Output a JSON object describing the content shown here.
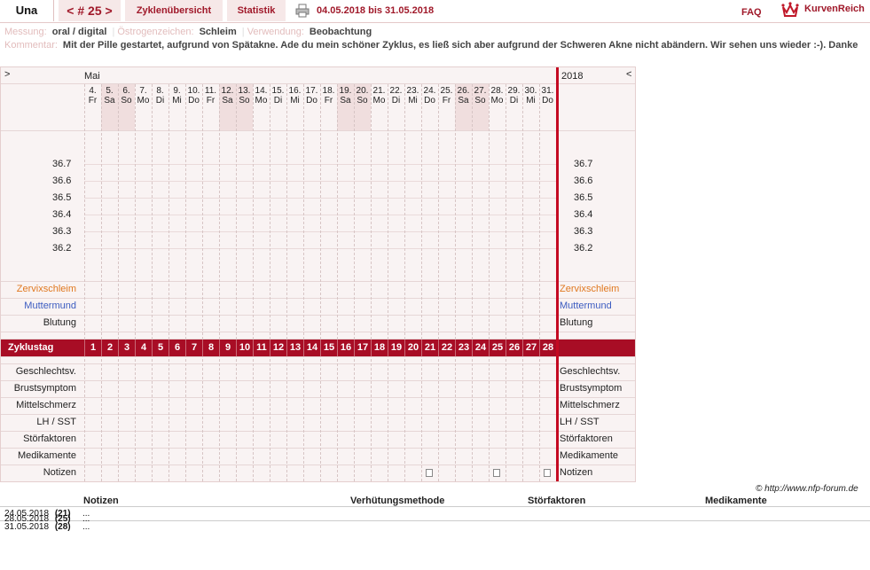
{
  "header": {
    "name": "Una",
    "cycle": "< # 25 >",
    "tab_overview": "Zyklenübersicht",
    "tab_stats": "Statistik",
    "date_range": "04.05.2018 bis 31.05.2018",
    "faq": "FAQ",
    "logo_text": "KurvenReich"
  },
  "meta": {
    "messung_label": "Messung:",
    "messung_value": "oral / digital",
    "oestro_label": "Östrogenzeichen:",
    "oestro_value": "Schleim",
    "verw_label": "Verwendung:",
    "verw_value": "Beobachtung",
    "komm_label": "Kommentar:",
    "komm_value": "Mit der Pille gestartet, aufgrund von Spätakne. Ade du mein schöner Zyklus, es ließ sich aber aufgrund der Schweren Akne nicht abändern. Wir sehen uns wieder :-). Danke"
  },
  "chart": {
    "nav_prev": ">",
    "nav_next": "<",
    "month": "Mai",
    "year": "2018",
    "days": [
      {
        "d": "4.",
        "w": "Fr"
      },
      {
        "d": "5.",
        "w": "Sa"
      },
      {
        "d": "6.",
        "w": "So"
      },
      {
        "d": "7.",
        "w": "Mo"
      },
      {
        "d": "8.",
        "w": "Di"
      },
      {
        "d": "9.",
        "w": "Mi"
      },
      {
        "d": "10.",
        "w": "Do"
      },
      {
        "d": "11.",
        "w": "Fr"
      },
      {
        "d": "12.",
        "w": "Sa"
      },
      {
        "d": "13.",
        "w": "So"
      },
      {
        "d": "14.",
        "w": "Mo"
      },
      {
        "d": "15.",
        "w": "Di"
      },
      {
        "d": "16.",
        "w": "Mi"
      },
      {
        "d": "17.",
        "w": "Do"
      },
      {
        "d": "18.",
        "w": "Fr"
      },
      {
        "d": "19.",
        "w": "Sa"
      },
      {
        "d": "20.",
        "w": "So"
      },
      {
        "d": "21.",
        "w": "Mo"
      },
      {
        "d": "22.",
        "w": "Di"
      },
      {
        "d": "23.",
        "w": "Mi"
      },
      {
        "d": "24.",
        "w": "Do"
      },
      {
        "d": "25.",
        "w": "Fr"
      },
      {
        "d": "26.",
        "w": "Sa"
      },
      {
        "d": "27.",
        "w": "So"
      },
      {
        "d": "28.",
        "w": "Mo"
      },
      {
        "d": "29.",
        "w": "Di"
      },
      {
        "d": "30.",
        "w": "Mi"
      },
      {
        "d": "31.",
        "w": "Do"
      }
    ],
    "temps": [
      "36.7",
      "36.6",
      "36.5",
      "36.4",
      "36.3",
      "36.2"
    ],
    "zervix": "Zervixschleim",
    "muttermund": "Muttermund",
    "blutung": "Blutung",
    "zyklustag": "Zyklustag",
    "lower_rows": [
      "Geschlechtsv.",
      "Brustsymptom",
      "Mittelschmerz",
      "LH / SST",
      "Störfaktoren",
      "Medikamente",
      "Notizen"
    ],
    "note_days": [
      21,
      25,
      28
    ]
  },
  "colors": {
    "accent": "#a0192a",
    "band": "#a80d25",
    "zervix": "#e07820",
    "muttermund": "#3c5cc0"
  },
  "bottom": {
    "copyright": "© http://www.nfp-forum.de",
    "col_notizen": "Notizen",
    "col_verh": "Verhütungsmethode",
    "col_stoer": "Störfaktoren",
    "col_medi": "Medikamente",
    "rows": [
      {
        "date": "24.05.2018",
        "day": "(21)",
        "text": "..."
      },
      {
        "date": "28.05.2018",
        "day": "(25)",
        "text": "..."
      },
      {
        "date": "31.05.2018",
        "day": "(28)",
        "text": "..."
      }
    ]
  }
}
